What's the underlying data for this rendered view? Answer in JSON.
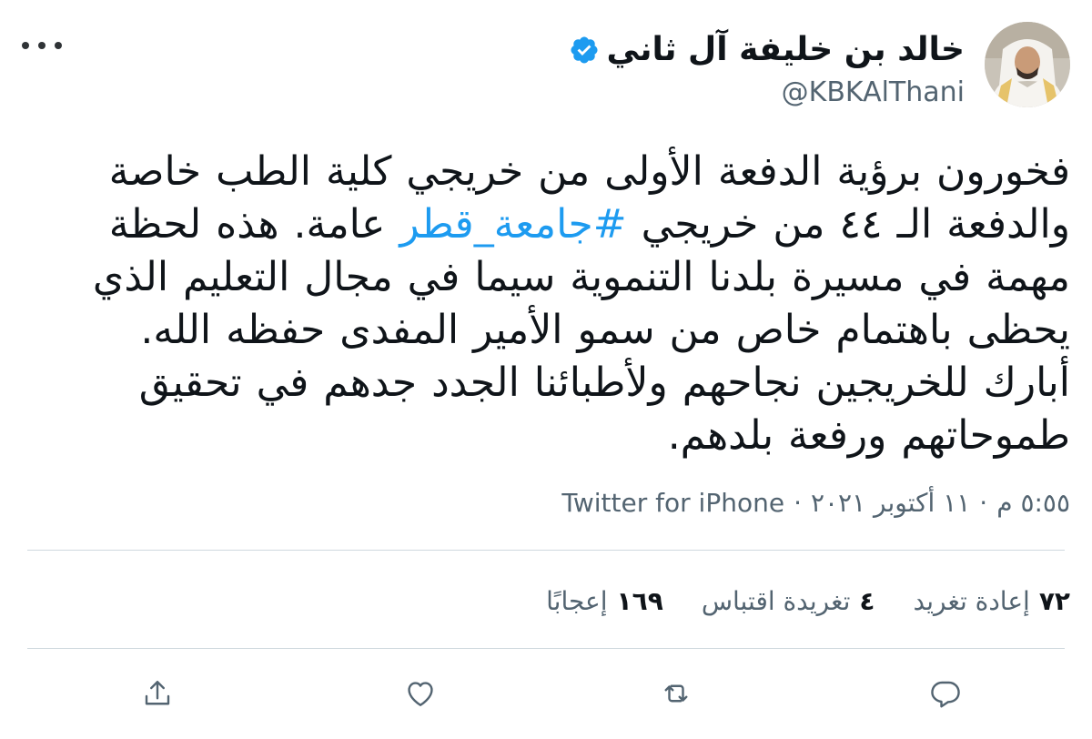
{
  "author": {
    "display_name": "خالد بن خليفة آل ثاني",
    "handle": "@KBKAlThani",
    "verified_icon": "verified-badge-icon",
    "avatar_icon": "avatar-photo"
  },
  "tweet": {
    "text_before_hashtag": "فخورون برؤية الدفعة الأولى من خريجي كلية الطب خاصة والدفعة الـ ٤٤ من خريجي ",
    "hashtag": "#جامعة_قطر",
    "text_after_hashtag": " عامة. هذه لحظة مهمة في مسيرة بلدنا التنموية سيما في مجال التعليم الذي يحظى باهتمام خاص من سمو الأمير المفدى حفظه الله. أبارك للخريجين نجاحهم ولأطبائنا الجدد جدهم في تحقيق طموحاتهم ورفعة بلدهم."
  },
  "meta": {
    "time": "٥:٥٥ م",
    "separator": "·",
    "date": "١١ أكتوبر ٢٠٢١",
    "source": "Twitter for iPhone"
  },
  "stats": {
    "retweets_count": "٧٢",
    "retweets_label": "إعادة تغريد",
    "quotes_count": "٤",
    "quotes_label": "تغريدة اقتباس",
    "likes_count": "١٦٩",
    "likes_label": "إعجابًا"
  },
  "icons": {
    "more": "more-options-icon",
    "reply": "reply-icon",
    "retweet": "retweet-icon",
    "like": "like-icon",
    "share": "share-icon"
  },
  "colors": {
    "text": "#0f1419",
    "secondary": "#536471",
    "link": "#1d9bf0",
    "divider": "#cfd9de"
  }
}
